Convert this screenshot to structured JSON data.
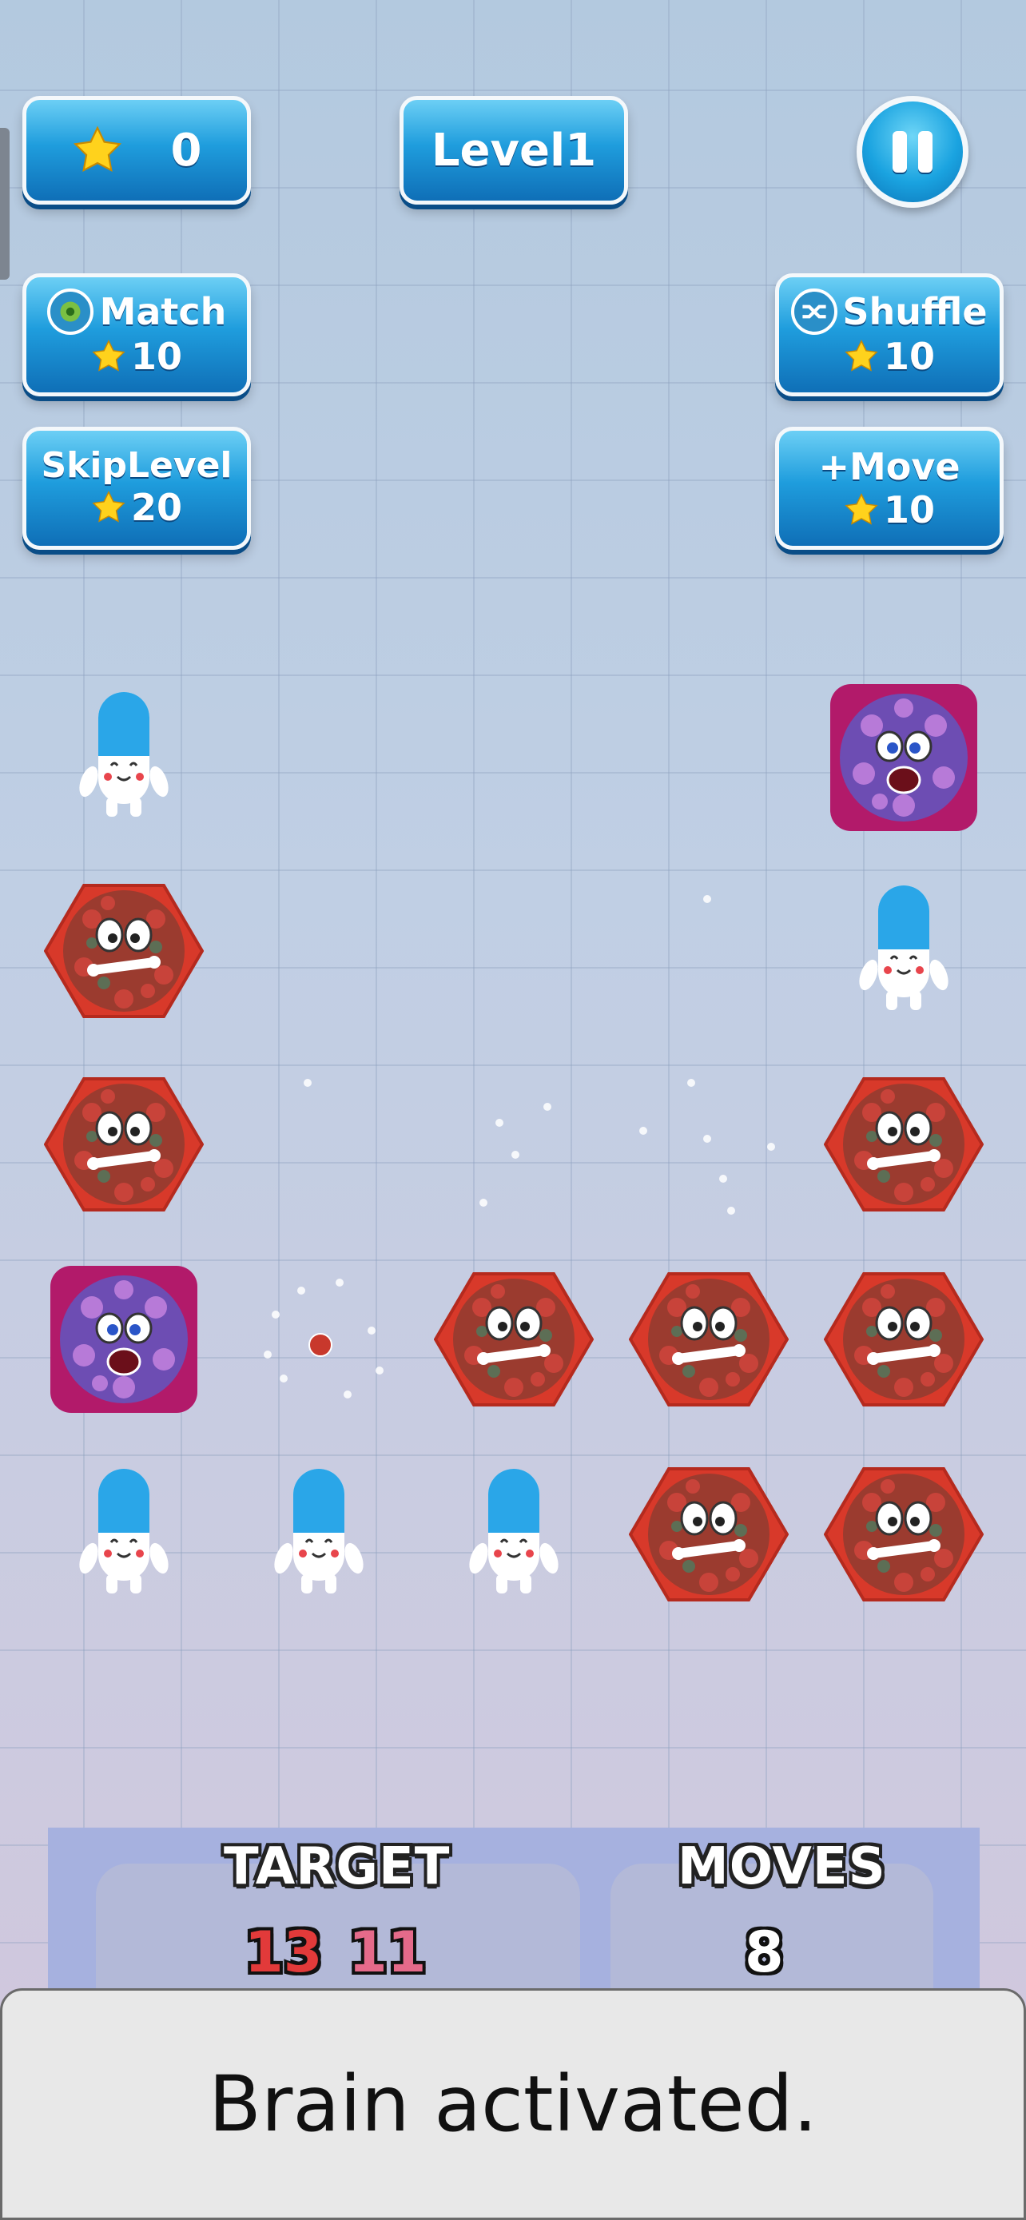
{
  "hud": {
    "score": "0",
    "level_label": "Level1"
  },
  "powerups": {
    "match": {
      "label": "Match",
      "cost": "10"
    },
    "shuffle": {
      "label": "Shuffle",
      "cost": "10"
    },
    "skip_level": {
      "label": "SkipLevel",
      "cost": "20"
    },
    "add_move": {
      "label": "+Move",
      "cost": "10"
    }
  },
  "board": {
    "rows": [
      [
        "pill",
        "empty",
        "empty",
        "empty",
        "virus-purple"
      ],
      [
        "virus-red",
        "empty",
        "empty",
        "empty",
        "pill"
      ],
      [
        "virus-red",
        "empty",
        "empty",
        "empty",
        "virus-red"
      ],
      [
        "virus-purple",
        "empty",
        "virus-red",
        "virus-red",
        "virus-red"
      ],
      [
        "pill",
        "pill",
        "pill",
        "virus-red",
        "virus-red"
      ]
    ]
  },
  "status": {
    "target_label": "TARGET",
    "target_red": "13",
    "target_purple": "11",
    "moves_label": "MOVES",
    "moves_value": "8"
  },
  "toast": {
    "message": "Brain activated."
  },
  "colors": {
    "button_blue": "#1f9ddd",
    "target_red": "#e23a3a",
    "target_purple": "#e56a8a",
    "panel": "#a6b1df"
  }
}
